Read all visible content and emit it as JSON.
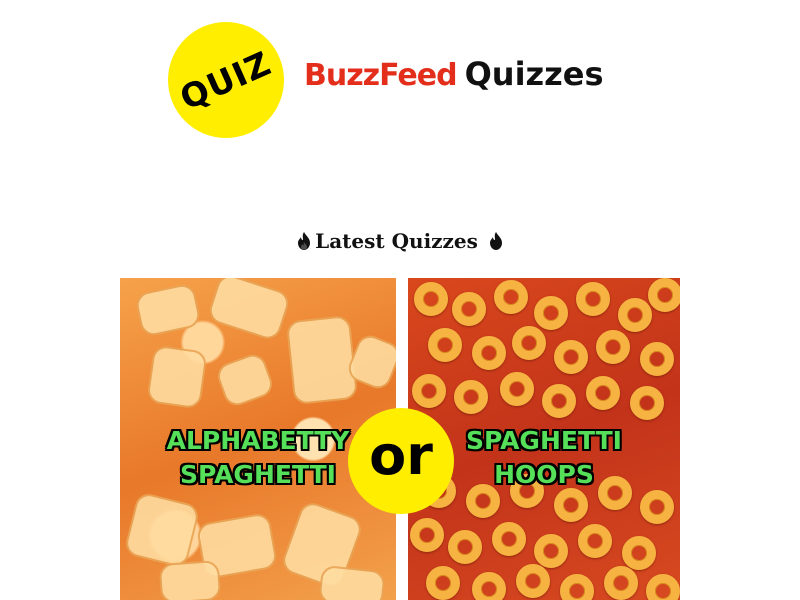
{
  "header": {
    "badge_text": "QUIZ",
    "brand_name": "BuzzFeed",
    "brand_suffix": "Quizzes",
    "colors": {
      "badge": "#ffee00",
      "brand": "#e42e1c"
    }
  },
  "section": {
    "title": "Latest Quizzes",
    "icon": "fire-icon"
  },
  "quiz_card": {
    "left_label_line1": "ALPHABETTY",
    "left_label_line2": "SPAGHETTI",
    "separator": "or",
    "right_label_line1": "SPAGHETTI",
    "right_label_line2": "HOOPS",
    "label_color": "#56e05a"
  }
}
